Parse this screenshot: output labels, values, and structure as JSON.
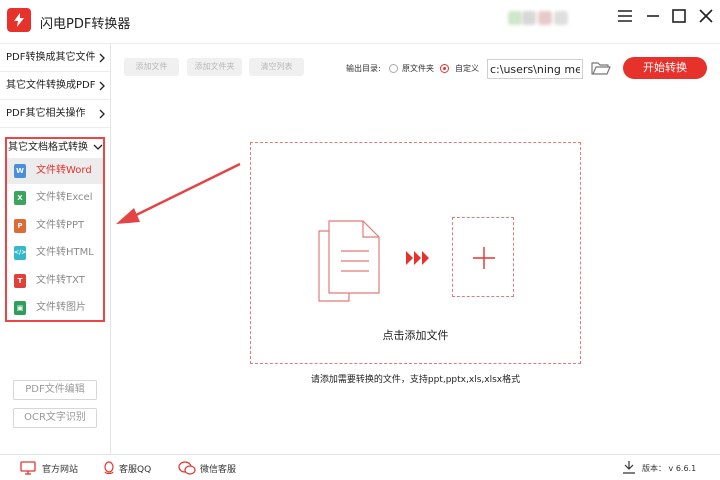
{
  "app": {
    "title": "闪电PDF转换器"
  },
  "sidebar": {
    "categories": [
      {
        "label": "PDF转换成其它文件"
      },
      {
        "label": "其它文件转换成PDF"
      },
      {
        "label": "PDF其它相关操作"
      }
    ],
    "expanded": {
      "label": "其它文档格式转换",
      "items": [
        {
          "label": "文件转Word",
          "badge": "W",
          "color": "#4a90d9"
        },
        {
          "label": "文件转Excel",
          "badge": "X",
          "color": "#3ba55c"
        },
        {
          "label": "文件转PPT",
          "badge": "P",
          "color": "#e06a35"
        },
        {
          "label": "文件转HTML",
          "badge": "</>",
          "color": "#35b8c9"
        },
        {
          "label": "文件转TXT",
          "badge": "T",
          "color": "#e0413a"
        },
        {
          "label": "文件转图片",
          "badge": "▣",
          "color": "#2f9e5b"
        }
      ]
    },
    "tools": [
      {
        "label": "PDF文件编辑"
      },
      {
        "label": "OCR文字识别"
      }
    ]
  },
  "toolbar": {
    "add_file": "添加文件",
    "add_folder": "添加文件夹",
    "clear_list": "清空列表",
    "output_label": "输出目录:",
    "option_original": "原文件夹",
    "option_custom": "自定义",
    "path_value": "c:\\users\\ning mei",
    "start": "开始转换"
  },
  "dropzone": {
    "text": "点击添加文件",
    "hint": "请添加需要转换的文件，支持ppt,pptx,xls,xlsx格式"
  },
  "status": {
    "website": "官方网站",
    "qq": "客服QQ",
    "wechat": "微信客服",
    "version": "版本： v 6.6.1"
  },
  "colors": {
    "accent": "#e7322c",
    "annotation": "#e44444"
  }
}
